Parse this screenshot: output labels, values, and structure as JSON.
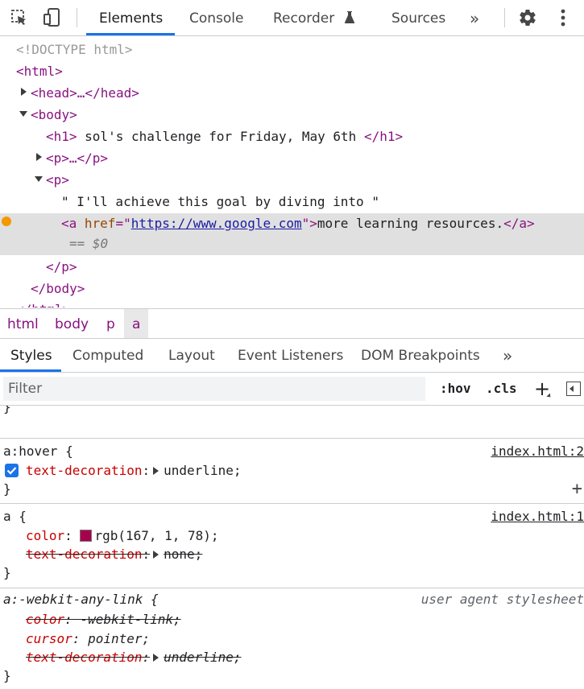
{
  "toolbar": {
    "tabs": [
      "Elements",
      "Console",
      "Recorder",
      "Sources"
    ],
    "more": "»",
    "icons": [
      "inspect-icon",
      "device-toggle-icon",
      "flask-icon",
      "gear-icon",
      "kebab-icon"
    ]
  },
  "dom": {
    "doctype": "<!DOCTYPE html>",
    "html_open": "<html>",
    "head": "<head>…</head>",
    "body_open": "<body>",
    "h1_open": "<h1>",
    "h1_text": " sol's challenge for Friday, May 6th ",
    "h1_close": "</h1>",
    "p_collapsed": "<p>…</p>",
    "p_open": "<p>",
    "p_text": "\" I'll achieve this goal by diving into \"",
    "a_open_start": "<a ",
    "a_attr": "href",
    "a_eq": "=\"",
    "a_href": "https://www.google.com",
    "a_quote_close": "\">",
    "a_text": "more learning resources.",
    "a_close": "</a>",
    "selected_marker": "== $0",
    "p_close": "</p>",
    "body_close": "</body>",
    "html_close": "</html>"
  },
  "breadcrumbs": [
    "html",
    "body",
    "p",
    "a"
  ],
  "styles_tabs": [
    "Styles",
    "Computed",
    "Layout",
    "Event Listeners",
    "DOM Breakpoints"
  ],
  "styles_more": "»",
  "filter": {
    "placeholder": "Filter",
    "hov": ":hov",
    "cls": ".cls",
    "add": "+"
  },
  "rules": {
    "element_style_close": "}",
    "hover": {
      "selector": "a:hover {",
      "source": "index.html:2",
      "prop": "text-decoration",
      "value": "underline;",
      "close": "}",
      "add": "+"
    },
    "a": {
      "selector": "a {",
      "source": "index.html:1",
      "color_prop": "color",
      "color_value": "rgb(167, 1, 78);",
      "swatch": "#a7014e",
      "td_prop": "text-decoration",
      "td_value": "none;",
      "close": "}"
    },
    "ua": {
      "selector": "a:-webkit-any-link {",
      "source": "user agent stylesheet",
      "color_prop": "color",
      "color_value": "-webkit-link;",
      "cursor_prop": "cursor",
      "cursor_value": "pointer;",
      "td_prop": "text-decoration",
      "td_value": "underline;",
      "close": "}"
    }
  },
  "colors": {
    "accent": "#1a73e8",
    "tag": "#881280",
    "attr": "#994500",
    "prop": "#c80000",
    "selected_row": "#e0e0e0"
  }
}
